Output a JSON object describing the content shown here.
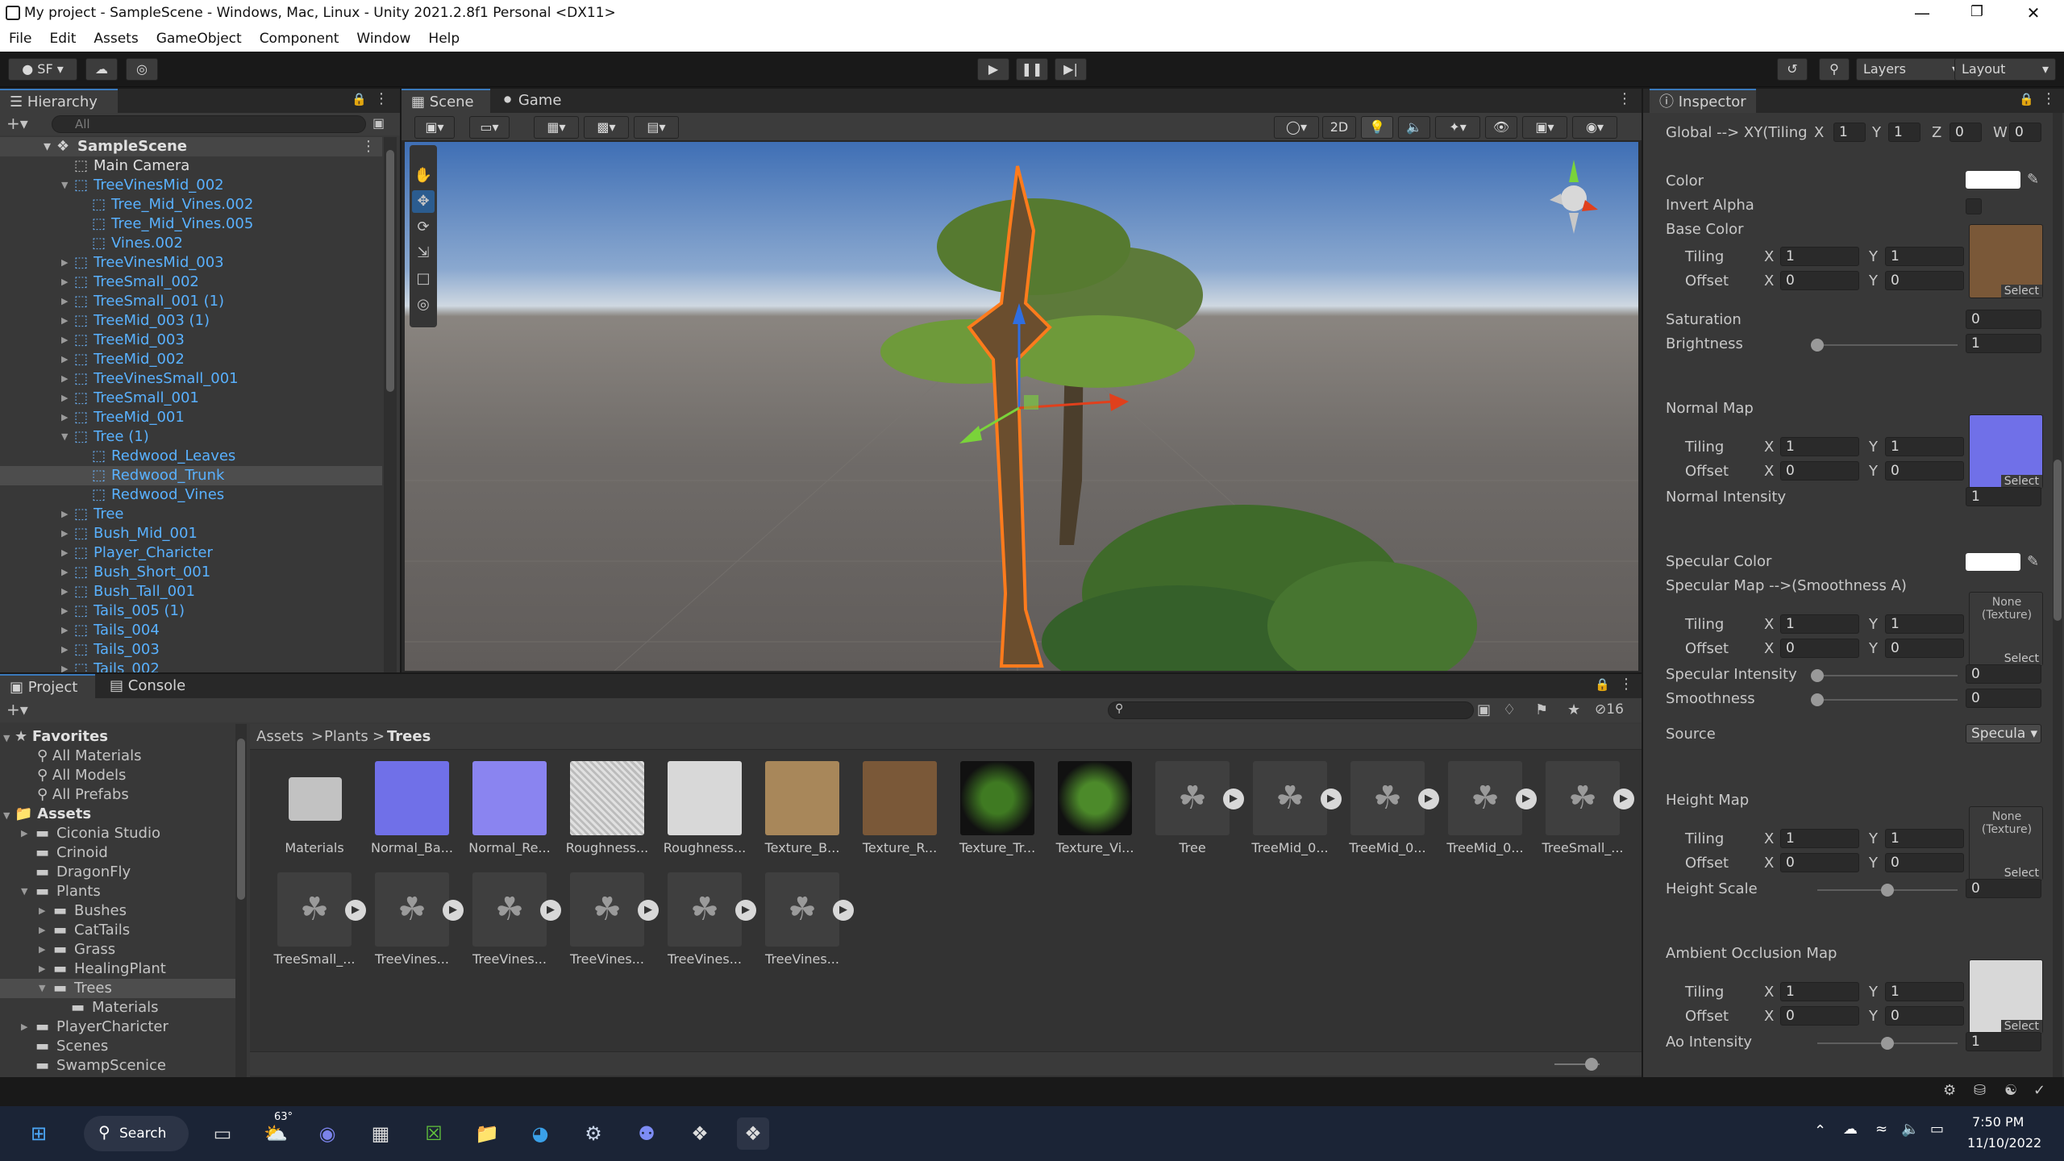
{
  "window": {
    "title": "My project - SampleScene - Windows, Mac, Linux - Unity 2021.2.8f1 Personal <DX11>"
  },
  "menu": [
    "File",
    "Edit",
    "Assets",
    "GameObject",
    "Component",
    "Window",
    "Help"
  ],
  "toolbar": {
    "account": "SF",
    "layers": "Layers",
    "layout": "Layout"
  },
  "hierarchy": {
    "tab": "Hierarchy",
    "search_placeholder": "All",
    "scene": "SampleScene",
    "items": [
      {
        "label": "Main Camera",
        "color": "white",
        "depth": 1
      },
      {
        "label": "TreeVinesMid_002",
        "color": "blue",
        "depth": 1,
        "arrow": "open"
      },
      {
        "label": "Tree_Mid_Vines.002",
        "color": "blue",
        "depth": 2
      },
      {
        "label": "Tree_Mid_Vines.005",
        "color": "blue",
        "depth": 2
      },
      {
        "label": "Vines.002",
        "color": "blue",
        "depth": 2
      },
      {
        "label": "TreeVinesMid_003",
        "color": "blue",
        "depth": 1,
        "arrow": "closed"
      },
      {
        "label": "TreeSmall_002",
        "color": "blue",
        "depth": 1,
        "arrow": "closed"
      },
      {
        "label": "TreeSmall_001 (1)",
        "color": "blue",
        "depth": 1,
        "arrow": "closed"
      },
      {
        "label": "TreeMid_003 (1)",
        "color": "blue",
        "depth": 1,
        "arrow": "closed"
      },
      {
        "label": "TreeMid_003",
        "color": "blue",
        "depth": 1,
        "arrow": "closed"
      },
      {
        "label": "TreeMid_002",
        "color": "blue",
        "depth": 1,
        "arrow": "closed"
      },
      {
        "label": "TreeVinesSmall_001",
        "color": "blue",
        "depth": 1,
        "arrow": "closed"
      },
      {
        "label": "TreeSmall_001",
        "color": "blue",
        "depth": 1,
        "arrow": "closed"
      },
      {
        "label": "TreeMid_001",
        "color": "blue",
        "depth": 1,
        "arrow": "closed"
      },
      {
        "label": "Tree (1)",
        "color": "blue",
        "depth": 1,
        "arrow": "open"
      },
      {
        "label": "Redwood_Leaves",
        "color": "blue",
        "depth": 2
      },
      {
        "label": "Redwood_Trunk",
        "color": "blue",
        "depth": 2,
        "selected": true
      },
      {
        "label": "Redwood_Vines",
        "color": "blue",
        "depth": 2
      },
      {
        "label": "Tree",
        "color": "blue",
        "depth": 1,
        "arrow": "closed"
      },
      {
        "label": "Bush_Mid_001",
        "color": "blue",
        "depth": 1,
        "arrow": "closed"
      },
      {
        "label": "Player_Charicter",
        "color": "blue",
        "depth": 1,
        "arrow": "closed"
      },
      {
        "label": "Bush_Short_001",
        "color": "blue",
        "depth": 1,
        "arrow": "closed"
      },
      {
        "label": "Bush_Tall_001",
        "color": "blue",
        "depth": 1,
        "arrow": "closed"
      },
      {
        "label": "Tails_005 (1)",
        "color": "blue",
        "depth": 1,
        "arrow": "closed"
      },
      {
        "label": "Tails_004",
        "color": "blue",
        "depth": 1,
        "arrow": "closed"
      },
      {
        "label": "Tails_003",
        "color": "blue",
        "depth": 1,
        "arrow": "closed"
      },
      {
        "label": "Tails_002",
        "color": "blue",
        "depth": 1,
        "arrow": "closed"
      }
    ]
  },
  "scene_view": {
    "tab_scene": "Scene",
    "tab_game": "Game",
    "btn_2d": "2D"
  },
  "project": {
    "tab_project": "Project",
    "tab_console": "Console",
    "hidden_count": "16",
    "breadcrumb": [
      "Assets",
      "Plants",
      "Trees"
    ],
    "favorites_label": "Favorites",
    "favorites": [
      "All Materials",
      "All Models",
      "All Prefabs"
    ],
    "assets_label": "Assets",
    "tree": [
      {
        "label": "Ciconia Studio",
        "depth": 1,
        "arrow": "closed"
      },
      {
        "label": "Crinoid",
        "depth": 1
      },
      {
        "label": "DragonFly",
        "depth": 1
      },
      {
        "label": "Plants",
        "depth": 1,
        "arrow": "open"
      },
      {
        "label": "Bushes",
        "depth": 2,
        "arrow": "closed"
      },
      {
        "label": "CatTails",
        "depth": 2,
        "arrow": "closed"
      },
      {
        "label": "Grass",
        "depth": 2,
        "arrow": "closed"
      },
      {
        "label": "HealingPlant",
        "depth": 2,
        "arrow": "closed"
      },
      {
        "label": "Trees",
        "depth": 2,
        "arrow": "open",
        "selected": true
      },
      {
        "label": "Materials",
        "depth": 3
      },
      {
        "label": "PlayerCharicter",
        "depth": 1,
        "arrow": "closed"
      },
      {
        "label": "Scenes",
        "depth": 1
      },
      {
        "label": "SwampScenice",
        "depth": 1
      }
    ],
    "assets_row1": [
      {
        "label": "Materials",
        "kind": "folder"
      },
      {
        "label": "Normal_Ba...",
        "kind": "normal"
      },
      {
        "label": "Normal_Re...",
        "kind": "normal2"
      },
      {
        "label": "Roughness...",
        "kind": "noise"
      },
      {
        "label": "Roughness...",
        "kind": "gray"
      },
      {
        "label": "Texture_B...",
        "kind": "tan"
      },
      {
        "label": "Texture_R...",
        "kind": "brown"
      },
      {
        "label": "Texture_Tr...",
        "kind": "leaves"
      },
      {
        "label": "Texture_Vi...",
        "kind": "vines"
      },
      {
        "label": "Tree",
        "kind": "model"
      },
      {
        "label": "TreeMid_0...",
        "kind": "model"
      },
      {
        "label": "TreeMid_0...",
        "kind": "model"
      },
      {
        "label": "TreeMid_0...",
        "kind": "model"
      },
      {
        "label": "TreeSmall_...",
        "kind": "model"
      }
    ],
    "assets_row2": [
      {
        "label": "TreeSmall_..."
      },
      {
        "label": "TreeVines..."
      },
      {
        "label": "TreeVines..."
      },
      {
        "label": "TreeVines..."
      },
      {
        "label": "TreeVines..."
      },
      {
        "label": "TreeVines..."
      }
    ]
  },
  "inspector": {
    "tab": "Inspector",
    "global_label": "Global --> XY(Tiling",
    "global": {
      "x": "1",
      "y": "1",
      "z": "0",
      "w": "0"
    },
    "color_label": "Color",
    "invert_alpha": "Invert Alpha",
    "base_color": "Base Color",
    "tiling": "Tiling",
    "offset": "Offset",
    "x": "X",
    "y": "Y",
    "z": "Z",
    "w": "W",
    "one": "1",
    "zero": "0",
    "select": "Select",
    "saturation": "Saturation",
    "saturation_val": "0",
    "brightness": "Brightness",
    "brightness_val": "1",
    "normal_map": "Normal Map",
    "normal_intensity": "Normal Intensity",
    "normal_intensity_val": "1",
    "specular_color": "Specular Color",
    "specular_map": "Specular Map -->(Smoothness A)",
    "none_texture": "None (Texture)",
    "specular_intensity": "Specular Intensity",
    "specular_intensity_val": "0",
    "smoothness": "Smoothness",
    "smoothness_val": "0",
    "source": "Source",
    "source_val": "Specula",
    "height_map": "Height Map",
    "height_scale": "Height Scale",
    "height_scale_val": "0",
    "ao_map": "Ambient Occlusion Map",
    "ao_intensity": "Ao Intensity",
    "ao_intensity_val": "1",
    "brightness_level": 0.0,
    "height_level": 0.5,
    "ao_level": 0.5
  },
  "taskbar": {
    "search": "Search",
    "weather": "63°",
    "time": "7:50 PM",
    "date": "11/10/2022"
  }
}
